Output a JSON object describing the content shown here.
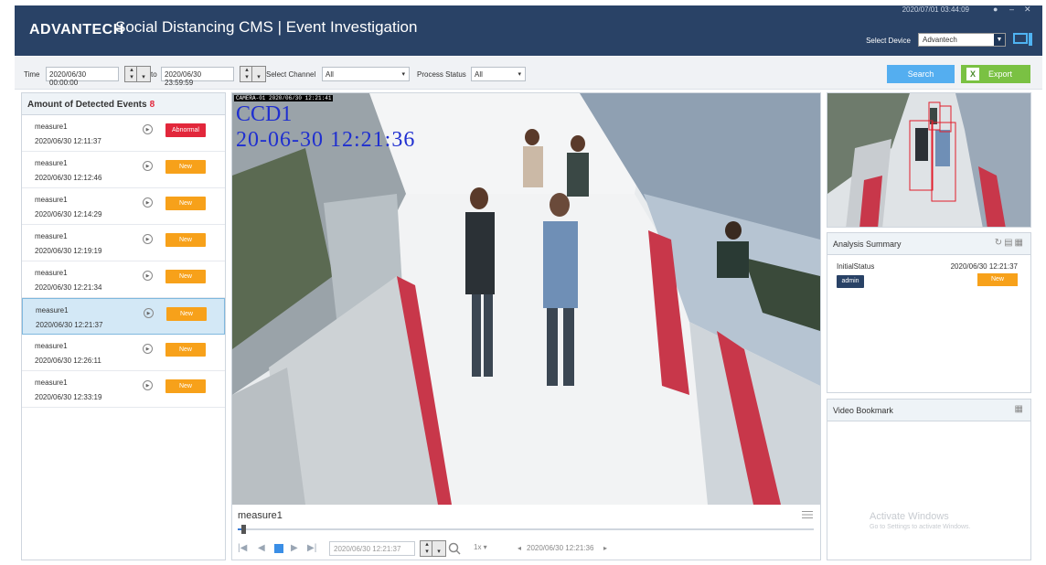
{
  "header": {
    "logo": "ADVANTECH",
    "title": "Social Distancing CMS | Event Investigation",
    "clock": "2020/07/01 03:44:09",
    "select_device_label": "Select Device",
    "device_value": "Advantech"
  },
  "filters": {
    "time_label": "Time",
    "time_from": "2020/06/30 00:00:00",
    "to_label": "to",
    "time_to": "2020/06/30 23:59:59",
    "channel_label": "Select Channel",
    "channel_value": "All",
    "status_label": "Process Status",
    "status_value": "All",
    "search_label": "Search",
    "export_label": "Export"
  },
  "events": {
    "title": "Amount of Detected Events",
    "count": "8",
    "items": [
      {
        "name": "measure1",
        "time": "2020/06/30 12:11:37",
        "status": "Abnormal"
      },
      {
        "name": "measure1",
        "time": "2020/06/30 12:12:46",
        "status": "New"
      },
      {
        "name": "measure1",
        "time": "2020/06/30 12:14:29",
        "status": "New"
      },
      {
        "name": "measure1",
        "time": "2020/06/30 12:19:19",
        "status": "New"
      },
      {
        "name": "measure1",
        "time": "2020/06/30 12:21:34",
        "status": "New"
      },
      {
        "name": "measure1",
        "time": "2020/06/30 12:21:37",
        "status": "New"
      },
      {
        "name": "measure1",
        "time": "2020/06/30 12:26:11",
        "status": "New"
      },
      {
        "name": "measure1",
        "time": "2020/06/30 12:33:19",
        "status": "New"
      }
    ],
    "selected_index": 5
  },
  "video": {
    "camera_overlay": "CAMERA-01 2020/06/30 12:21:41",
    "ccd_label": "CCD1",
    "ccd_time": "20-06-30 12:21:36",
    "clip_title": "measure1",
    "progress": 0.01,
    "timestamp": "2020/06/30 12:21:37",
    "speed": "1x",
    "nav_timestamp": "2020/06/30 12:21:36"
  },
  "analysis": {
    "title": "Analysis Summary",
    "status_label": "InitialStatus",
    "status_time": "2020/06/30 12:21:37",
    "user": "admin",
    "badge": "New"
  },
  "bookmark": {
    "title": "Video Bookmark",
    "watermark_title": "Activate Windows",
    "watermark_sub": "Go to Settings to activate Windows."
  },
  "colors": {
    "header_bg": "#294266",
    "new_badge": "#f7a11a",
    "abnormal_badge": "#e2273b",
    "search_btn": "#54aef0",
    "export_btn": "#7ac143"
  }
}
